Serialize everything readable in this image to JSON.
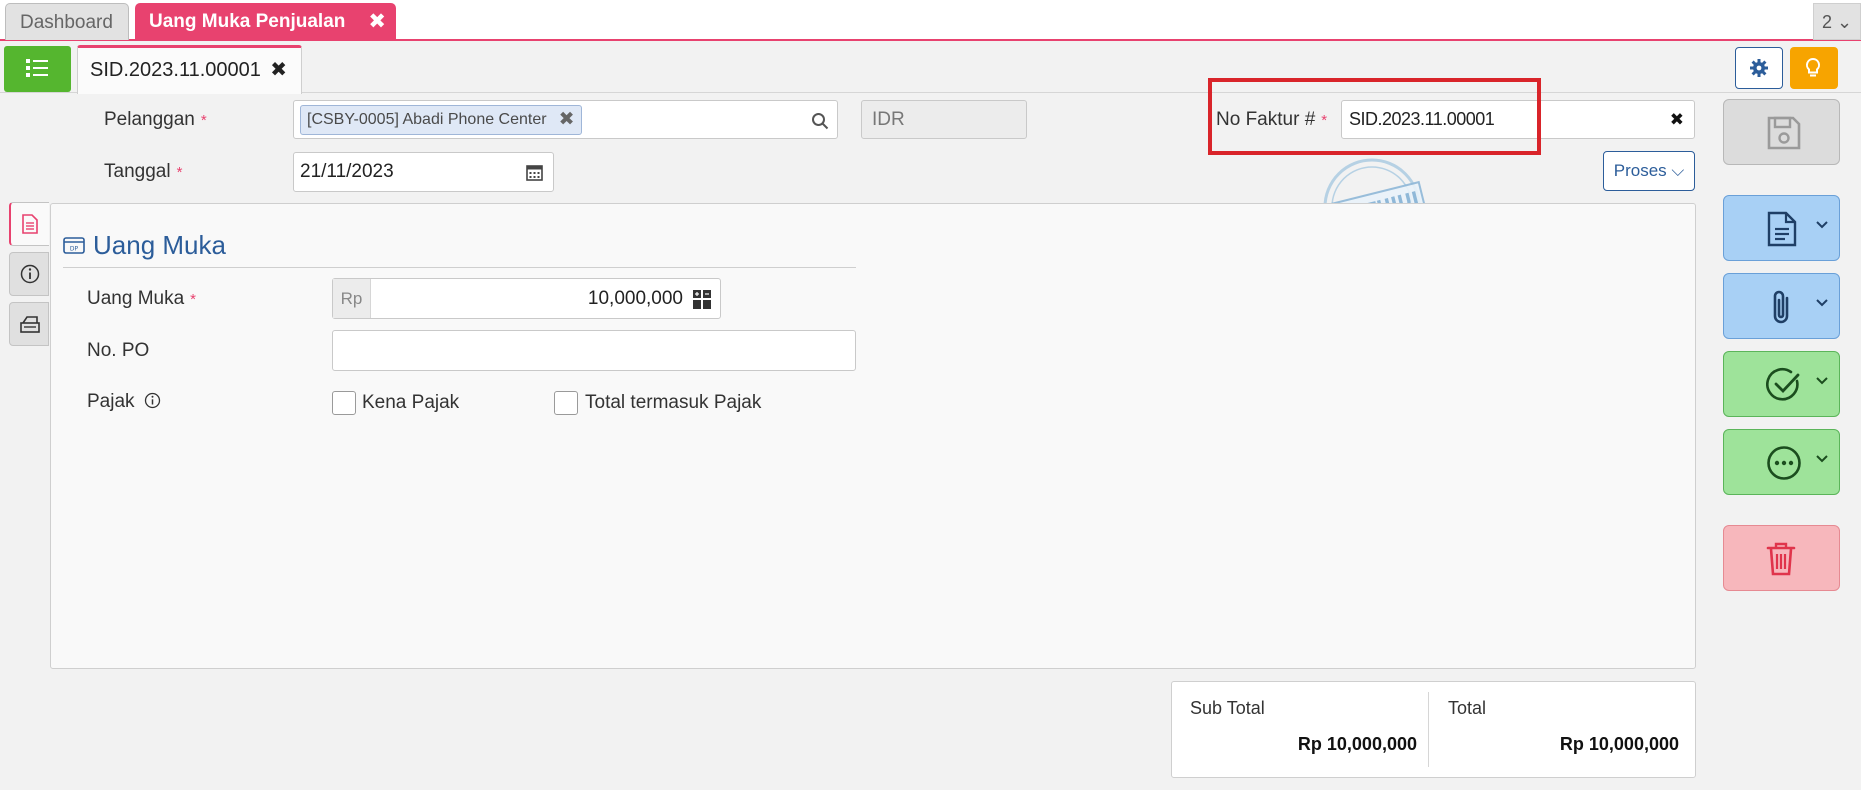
{
  "tabs": {
    "dashboard": "Dashboard",
    "active": "Uang Muka Penjualan",
    "count": "2"
  },
  "doc_tab": {
    "label": "SID.2023.11.00001"
  },
  "header": {
    "pelanggan_label": "Pelanggan",
    "pelanggan_value": "[CSBY-0005] Abadi Phone Center",
    "currency": "IDR",
    "tanggal_label": "Tanggal",
    "tanggal_value": "21/11/2023",
    "no_faktur_label": "No Faktur #",
    "no_faktur_value": "SID.2023.11.00001",
    "required_mark": "*",
    "proses_label": "Proses",
    "stamp_text": "DISETUJUI"
  },
  "section": {
    "title": "Uang Muka",
    "uang_muka_label": "Uang Muka",
    "currency_prefix": "Rp",
    "uang_muka_value": "10,000,000",
    "no_po_label": "No. PO",
    "no_po_value": "",
    "pajak_label": "Pajak",
    "kena_pajak_label": "Kena Pajak",
    "total_termasuk_label": "Total termasuk Pajak"
  },
  "totals": {
    "sub_total_label": "Sub Total",
    "sub_total_value": "Rp 10,000,000",
    "total_label": "Total",
    "total_value": "Rp 10,000,000"
  },
  "colors": {
    "accent": "#e8426f",
    "primary": "#2c5d9a",
    "menu_green": "#55b62f",
    "warning": "#f7a400",
    "highlight_red": "#d9242a"
  }
}
